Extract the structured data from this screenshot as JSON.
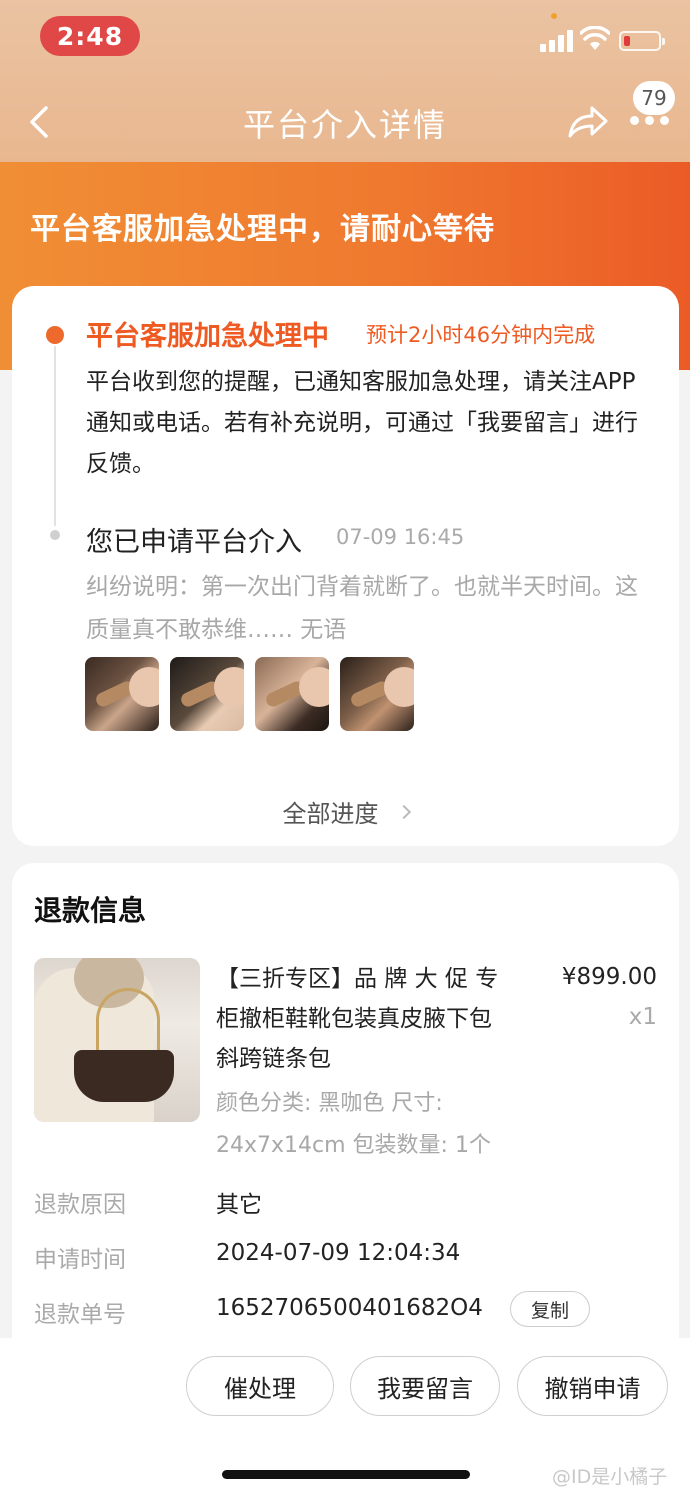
{
  "status_bar": {
    "time": "2:48",
    "battery_color": "#e03a3a"
  },
  "nav": {
    "title": "平台介入详情",
    "badge_count": "79"
  },
  "banner": {
    "text": "平台客服加急处理中，请耐心等待"
  },
  "progress": {
    "step1": {
      "title": "平台客服加急处理中",
      "eta": "预计2小时46分钟内完成",
      "body": "平台收到您的提醒，已通知客服加急处理，请关注APP通知或电话。若有补充说明，可通过「我要留言」进行反馈。"
    },
    "step2": {
      "title": "您已申请平台介入",
      "time": "07-09 16:45",
      "body": "纠纷说明：第一次出门背着就断了。也就半天时间。这质量真不敢恭维…… 无语"
    },
    "all_progress_label": "全部进度"
  },
  "refund": {
    "title": "退款信息",
    "product": {
      "name": "【三折专区】品 牌 大 促 专柜撤柜鞋靴包装真皮腋下包斜跨链条包",
      "price": "¥899.00",
      "qty": "x1",
      "spec": "颜色分类: 黑咖色 尺寸: 24x7x14cm 包装数量: 1个"
    },
    "rows": [
      {
        "label": "退款原因",
        "value": "其它"
      },
      {
        "label": "申请时间",
        "value": "2024-07-09 12:04:34"
      },
      {
        "label": "退款单号",
        "value": "1652706500401682O4",
        "action": "复制"
      }
    ]
  },
  "actions": {
    "urge": "催处理",
    "message": "我要留言",
    "cancel": "撤销申请"
  },
  "watermark": "@ID是小橘子",
  "colors": {
    "accent": "#ee5a22",
    "banner_start": "#f08e35",
    "banner_end": "#ec5b26"
  }
}
